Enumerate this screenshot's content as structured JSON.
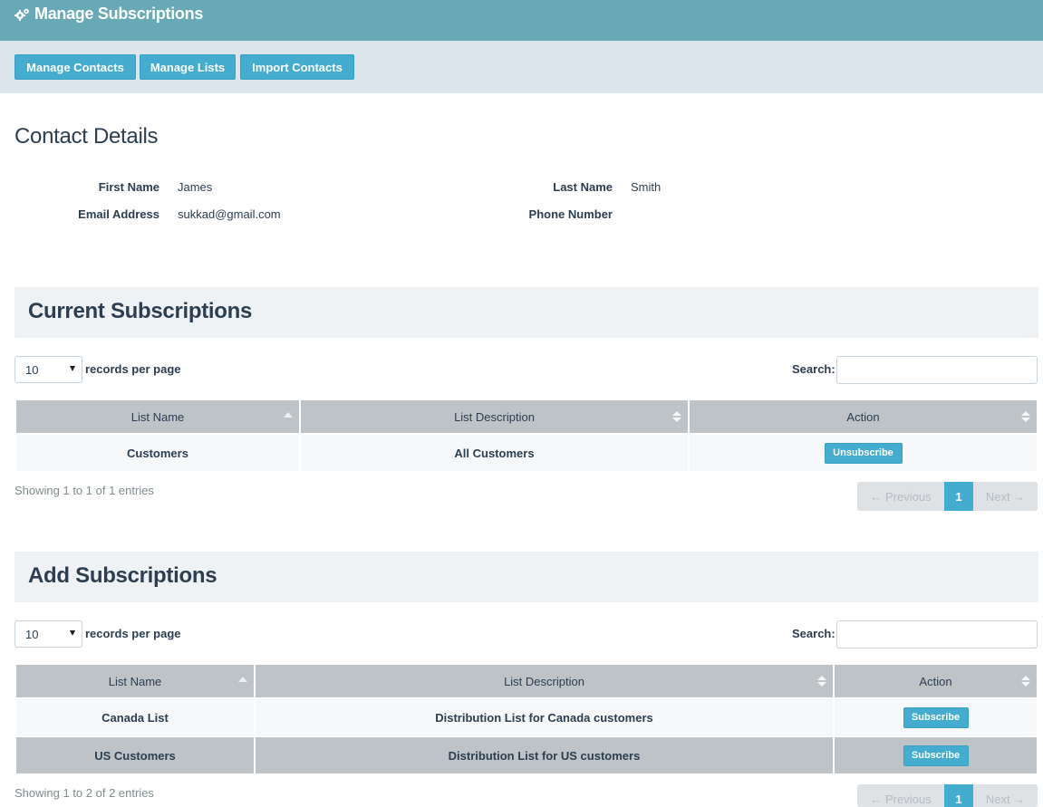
{
  "header": {
    "title": "Manage Subscriptions",
    "icon": "gears-icon"
  },
  "nav": {
    "buttons": [
      {
        "label": "Manage Contacts"
      },
      {
        "label": "Manage Lists"
      },
      {
        "label": "Import Contacts"
      }
    ]
  },
  "contact": {
    "heading": "Contact Details",
    "first_name_label": "First Name",
    "first_name": "James",
    "last_name_label": "Last Name",
    "last_name": "Smith",
    "email_label": "Email Address",
    "email": "sukkad@gmail.com",
    "phone_label": "Phone Number",
    "phone": ""
  },
  "current": {
    "title": "Current Subscriptions",
    "per_page_value": "10",
    "per_page_label": "records per page",
    "search_label": "Search:",
    "columns": [
      "List Name",
      "List Description",
      "Action"
    ],
    "rows": [
      {
        "name": "Customers",
        "description": "All Customers",
        "action": "Unsubscribe"
      }
    ],
    "showing": "Showing 1 to 1 of 1 entries",
    "pager": {
      "prev": "← Previous",
      "page": "1",
      "next": "Next →"
    }
  },
  "add": {
    "title": "Add Subscriptions",
    "per_page_value": "10",
    "per_page_label": "records per page",
    "search_label": "Search:",
    "columns": [
      "List Name",
      "List Description",
      "Action"
    ],
    "rows": [
      {
        "name": "Canada List",
        "description": "Distribution List for Canada customers",
        "action": "Subscribe"
      },
      {
        "name": "US Customers",
        "description": "Distribution List for US customers",
        "action": "Subscribe"
      }
    ],
    "showing": "Showing 1 to 2 of 2 entries",
    "pager": {
      "prev": "← Previous",
      "page": "1",
      "next": "Next →"
    }
  },
  "colors": {
    "header_bg": "#68a9b6",
    "nav_bg": "#dde5ec",
    "accent": "#44acce",
    "table_header": "#bdc3c7",
    "text": "#2c3e50"
  }
}
